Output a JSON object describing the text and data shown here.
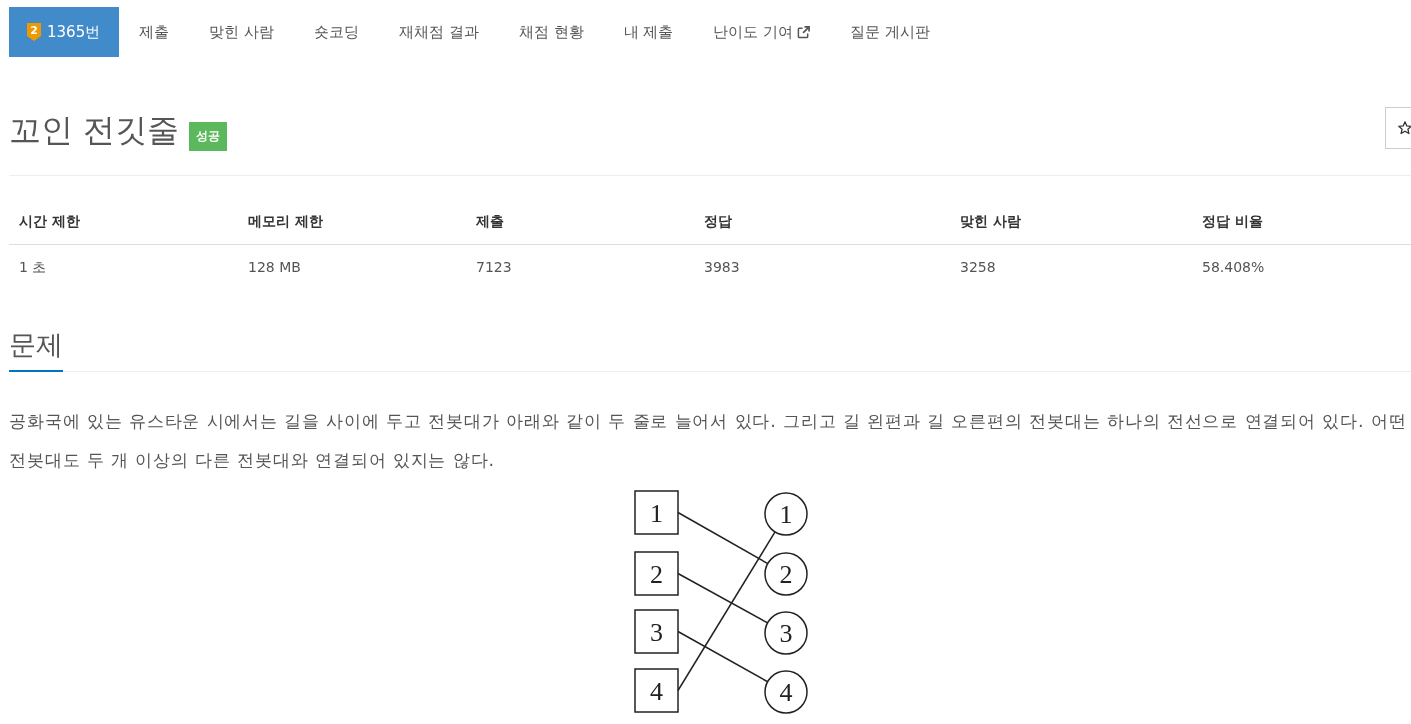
{
  "nav": {
    "items": [
      {
        "kind": "problem",
        "tier": "2",
        "label": "1365번",
        "selected": true
      },
      {
        "kind": "link",
        "label": "제출",
        "selected": false
      },
      {
        "kind": "link",
        "label": "맞힌 사람",
        "selected": false
      },
      {
        "kind": "link",
        "label": "숏코딩",
        "selected": false
      },
      {
        "kind": "link",
        "label": "재채점 결과",
        "selected": false
      },
      {
        "kind": "link",
        "label": "채점 현황",
        "selected": false
      },
      {
        "kind": "link",
        "label": "내 제출",
        "selected": false
      },
      {
        "kind": "external",
        "label": "난이도 기여",
        "selected": false
      },
      {
        "kind": "link",
        "label": "질문 게시판",
        "selected": false
      }
    ]
  },
  "problem": {
    "title": "꼬인 전깃줄",
    "result_badge": "성공",
    "starred": false
  },
  "info_table": {
    "columns": [
      "시간 제한",
      "메모리 제한",
      "제출",
      "정답",
      "맞힌 사람",
      "정답 비율"
    ],
    "rows": [
      [
        "1 초",
        "128 MB",
        "7123",
        "3983",
        "3258",
        "58.408%"
      ]
    ]
  },
  "section": {
    "heading": "문제",
    "lines": [
      "공화국에 있는 유스타운 시에서는 길을 사이에 두고 전봇대가 아래와 같이 두 줄로 늘어서 있다. 그리고 길 왼편과 길 오른편의 전봇대는 하나의 전선으로 연결되어 있다. 어떤",
      "전봇대도 두 개 이상의 다른 전봇대와 연결되어 있지는 않다."
    ]
  },
  "diagram": {
    "left_poles": [
      {
        "label": "1"
      },
      {
        "label": "2"
      },
      {
        "label": "3"
      },
      {
        "label": "4"
      }
    ],
    "right_poles": [
      {
        "label": "1"
      },
      {
        "label": "2"
      },
      {
        "label": "3"
      },
      {
        "label": "4"
      }
    ]
  }
}
